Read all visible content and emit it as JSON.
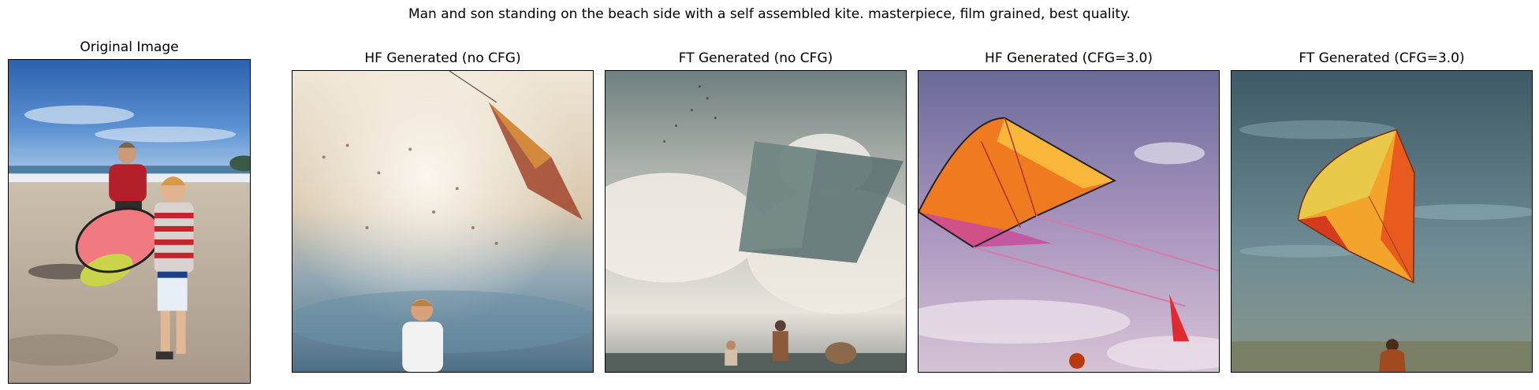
{
  "figure": {
    "suptitle": "Man and son standing on the beach side with a self assembled kite. masterpiece, film grained, best quality."
  },
  "panels": [
    {
      "title": "Original Image"
    },
    {
      "title": "HF Generated (no CFG)"
    },
    {
      "title": "FT Generated (no CFG)"
    },
    {
      "title": "HF Generated (CFG=3.0)"
    },
    {
      "title": "FT Generated (CFG=3.0)"
    }
  ]
}
